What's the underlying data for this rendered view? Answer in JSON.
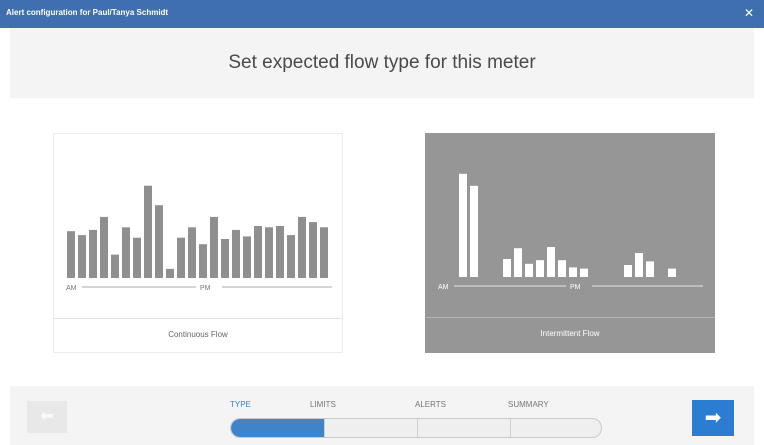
{
  "window": {
    "title": "Alert configuration for Paul/Tanya Schmidt",
    "close_glyph": "✕"
  },
  "heading": "Set expected flow type for this meter",
  "cards": {
    "continuous": {
      "label": "Continuous Flow",
      "am_label": "AM",
      "pm_label": "PM",
      "bar_color": "#8f8f8f",
      "bar_levels": [
        0.36,
        0.33,
        0.37,
        0.47,
        0.18,
        0.39,
        0.31,
        0.71,
        0.56,
        0.07,
        0.31,
        0.39,
        0.26,
        0.47,
        0.3,
        0.37,
        0.32,
        0.4,
        0.39,
        0.4,
        0.33,
        0.47,
        0.43,
        0.39
      ]
    },
    "intermittent": {
      "label": "Intermittent Flow",
      "am_label": "AM",
      "pm_label": "PM",
      "bar_color": "#ffffff",
      "bar_levels": [
        0.86,
        0.76,
        0,
        0,
        0.15,
        0.24,
        0.11,
        0.14,
        0.25,
        0.14,
        0.08,
        0.07,
        0,
        0,
        0,
        0.1,
        0.2,
        0.13,
        0,
        0.07
      ]
    }
  },
  "footer": {
    "back_icon": "arrow-left-icon",
    "next_icon": "arrow-right-icon",
    "back_glyph": "⬅",
    "next_glyph": "➡",
    "steps": [
      "TYPE",
      "LIMITS",
      "ALERTS",
      "SUMMARY"
    ],
    "active_step": "TYPE",
    "progress_fraction": 0.25
  },
  "colors": {
    "accent": "#3f84c9",
    "titlebar": "#3f6fae",
    "next_button": "#2a7dd1"
  }
}
